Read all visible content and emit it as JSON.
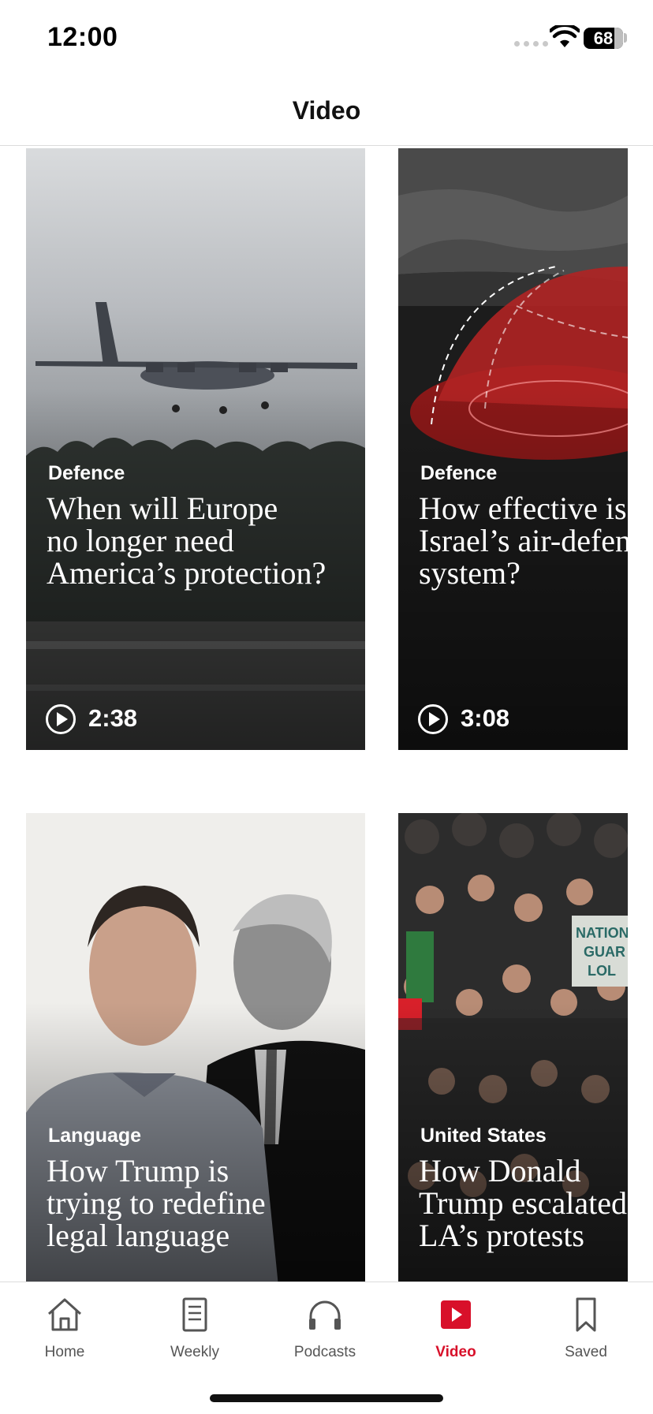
{
  "status_bar": {
    "time": "12:00",
    "battery": "68"
  },
  "header": {
    "title": "Video"
  },
  "videos": [
    {
      "category": "Defence",
      "headline": "When will Europe\nno longer need\nAmerica’s protection?",
      "duration": "2:38"
    },
    {
      "category": "Defence",
      "headline": "How effective is\nIsrael’s air-defen\nsystem?",
      "duration": "3:08"
    },
    {
      "category": "Language",
      "headline": "How Trump is\ntrying to redefine\nlegal language"
    },
    {
      "category": "United States",
      "headline": "How Donald\nTrump escalated\nLA’s protests"
    }
  ],
  "tabs": [
    {
      "label": "Home",
      "icon": "home-icon"
    },
    {
      "label": "Weekly",
      "icon": "weekly-icon"
    },
    {
      "label": "Podcasts",
      "icon": "headphones-icon"
    },
    {
      "label": "Video",
      "icon": "video-play-icon",
      "active": true
    },
    {
      "label": "Saved",
      "icon": "bookmark-icon"
    }
  ],
  "colors": {
    "accent": "#d8102a",
    "text": "#111111",
    "muted": "#555555"
  }
}
